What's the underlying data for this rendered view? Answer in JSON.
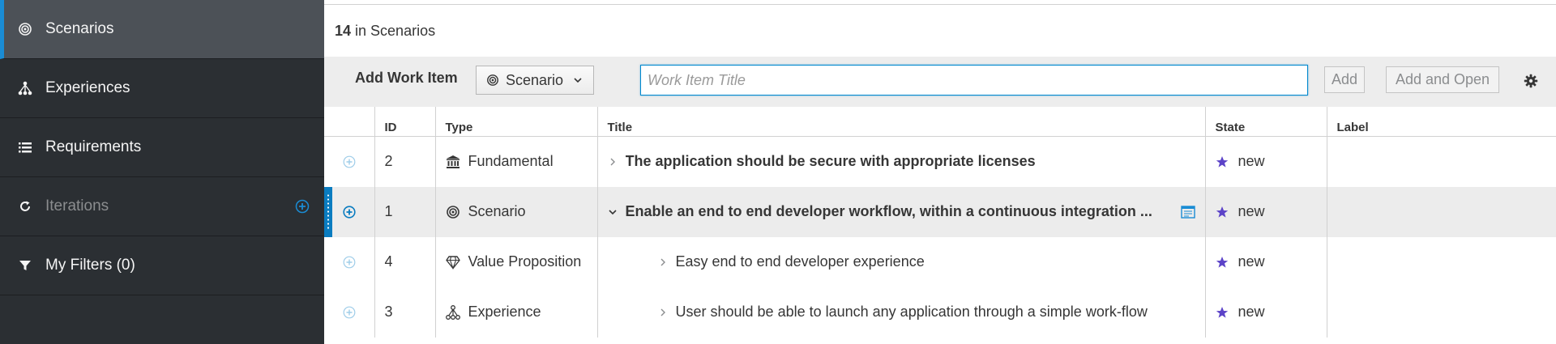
{
  "sidebar": {
    "items": [
      {
        "label": "Scenarios",
        "icon": "target-icon",
        "active": true
      },
      {
        "label": "Experiences",
        "icon": "hierarchy-icon"
      },
      {
        "label": "Requirements",
        "icon": "list-icon"
      },
      {
        "label": "Iterations",
        "icon": "refresh-icon",
        "disabled": true
      },
      {
        "label": "My Filters (0)",
        "icon": "filter-icon"
      }
    ]
  },
  "header": {
    "count": "14",
    "count_suffix": "in Scenarios"
  },
  "add_bar": {
    "label": "Add Work Item",
    "type_selected": "Scenario",
    "title_placeholder": "Work Item Title",
    "title_value": "",
    "add_label": "Add",
    "add_open_label": "Add and Open"
  },
  "table": {
    "columns": [
      "",
      "ID",
      "Type",
      "Title",
      "State",
      "Label"
    ],
    "rows": [
      {
        "id": "2",
        "type": "Fundamental",
        "type_icon": "bank-icon",
        "title": "The application should be secure with appropriate licenses",
        "state": "new",
        "label": ""
      },
      {
        "id": "1",
        "type": "Scenario",
        "type_icon": "target-icon",
        "title": "Enable an end to end developer workflow, within a continuous integration ...",
        "state": "new",
        "label": ""
      },
      {
        "id": "4",
        "type": "Value Proposition",
        "type_icon": "diamond-icon",
        "title": "Easy end to end developer experience",
        "state": "new",
        "label": ""
      },
      {
        "id": "3",
        "type": "Experience",
        "type_icon": "hierarchy-icon",
        "title": "User should be able to launch any application through a simple work-flow",
        "state": "new",
        "label": ""
      }
    ]
  },
  "colors": {
    "sidebar_bg": "#2b2f33",
    "sidebar_active": "#4c5157",
    "accent": "#1a8cd4",
    "star": "#5c43c8"
  }
}
